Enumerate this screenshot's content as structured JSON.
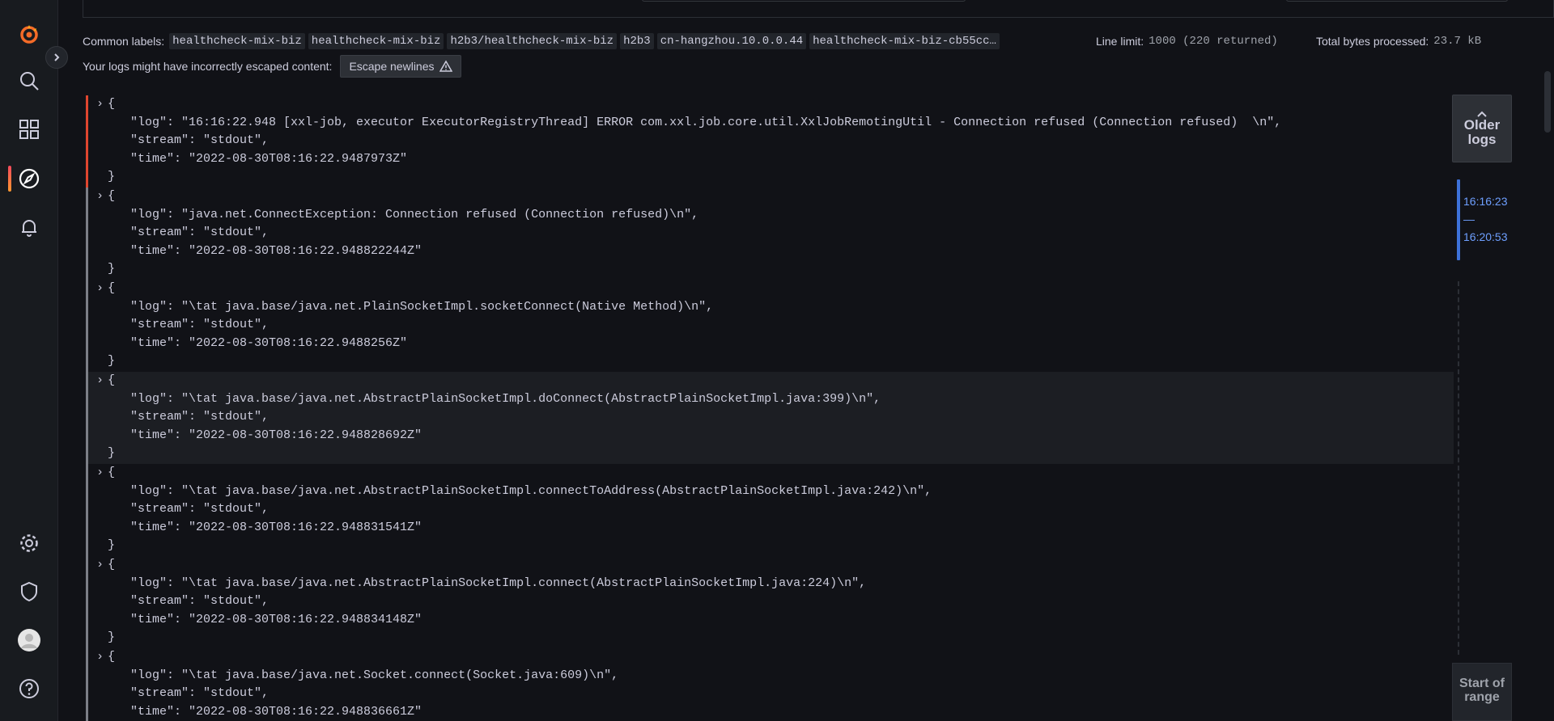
{
  "sidebar": {
    "icons": [
      "grafana-logo-icon",
      "search-icon",
      "dashboards-icon",
      "explore-icon",
      "alerting-icon",
      "settings-icon",
      "shield-icon",
      "avatar",
      "help-icon"
    ],
    "active": "explore-icon"
  },
  "meta": {
    "common_labels_label": "Common labels:",
    "labels": [
      "healthcheck-mix-biz",
      "healthcheck-mix-biz",
      "h2b3/healthcheck-mix-biz",
      "h2b3",
      "cn-hangzhou.10.0.0.44",
      "healthcheck-mix-biz-cb55cc…"
    ],
    "line_limit_label": "Line limit:",
    "line_limit_value": "1000 (220 returned)",
    "bytes_label": "Total bytes processed:",
    "bytes_value": "23.7 kB",
    "escape_warning": "Your logs might have incorrectly escaped content:",
    "escape_button": "Escape newlines"
  },
  "logs": [
    {
      "level": "error",
      "open": "{",
      "log": "  \"log\": \"16:16:22.948 [xxl-job, executor ExecutorRegistryThread] ERROR com.xxl.job.core.util.XxlJobRemotingUtil - Connection refused (Connection refused)  \\n\",",
      "stream": "  \"stream\": \"stdout\",",
      "time": "  \"time\": \"2022-08-30T08:16:22.9487973Z\"",
      "close": "}"
    },
    {
      "level": "unknown",
      "open": "{",
      "log": "  \"log\": \"java.net.ConnectException: Connection refused (Connection refused)\\n\",",
      "stream": "  \"stream\": \"stdout\",",
      "time": "  \"time\": \"2022-08-30T08:16:22.948822244Z\"",
      "close": "}"
    },
    {
      "level": "unknown",
      "open": "{",
      "log": "  \"log\": \"\\tat java.base/java.net.PlainSocketImpl.socketConnect(Native Method)\\n\",",
      "stream": "  \"stream\": \"stdout\",",
      "time": "  \"time\": \"2022-08-30T08:16:22.9488256Z\"",
      "close": "}"
    },
    {
      "level": "unknown",
      "open": "{",
      "log": "  \"log\": \"\\tat java.base/java.net.AbstractPlainSocketImpl.doConnect(AbstractPlainSocketImpl.java:399)\\n\",",
      "stream": "  \"stream\": \"stdout\",",
      "time": "  \"time\": \"2022-08-30T08:16:22.948828692Z\"",
      "close": "}"
    },
    {
      "level": "unknown",
      "open": "{",
      "log": "  \"log\": \"\\tat java.base/java.net.AbstractPlainSocketImpl.connectToAddress(AbstractPlainSocketImpl.java:242)\\n\",",
      "stream": "  \"stream\": \"stdout\",",
      "time": "  \"time\": \"2022-08-30T08:16:22.948831541Z\"",
      "close": "}"
    },
    {
      "level": "unknown",
      "open": "{",
      "log": "  \"log\": \"\\tat java.base/java.net.AbstractPlainSocketImpl.connect(AbstractPlainSocketImpl.java:224)\\n\",",
      "stream": "  \"stream\": \"stdout\",",
      "time": "  \"time\": \"2022-08-30T08:16:22.948834148Z\"",
      "close": "}"
    },
    {
      "level": "unknown",
      "open": "{",
      "log": "  \"log\": \"\\tat java.base/java.net.Socket.connect(Socket.java:609)\\n\",",
      "stream": "  \"stream\": \"stdout\",",
      "time": "  \"time\": \"2022-08-30T08:16:22.948836661Z\"",
      "close": "}"
    }
  ],
  "nav": {
    "older_logs": "Older logs",
    "range_start": "16:16:23",
    "range_sep": "—",
    "range_end": "16:20:53",
    "start_of_range": "Start of range"
  },
  "colors": {
    "error": "#e0462f",
    "unknown": "#7c7f87",
    "range": "#3d71d9"
  }
}
